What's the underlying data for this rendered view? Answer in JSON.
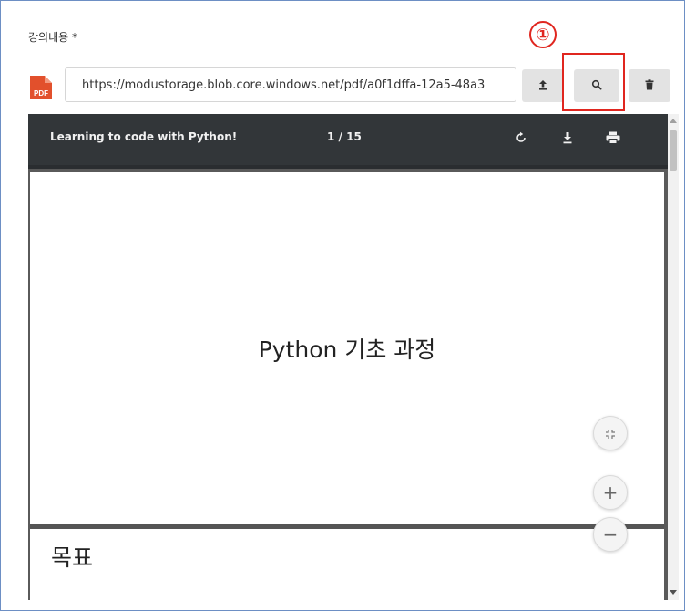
{
  "form": {
    "field_label": "강의내용 *",
    "url_value": "https://modustorage.blob.core.windows.net/pdf/a0f1dffa-12a5-48a3",
    "file_type_badge": "PDF"
  },
  "annotation": {
    "step_number": "①",
    "color": "#e0261f"
  },
  "toolbar_buttons": {
    "upload_icon": "upload-icon",
    "search_icon": "search-icon",
    "delete_icon": "trash-icon"
  },
  "viewer": {
    "document_title": "Learning to code with Python!",
    "page_counter": "1 / 15",
    "toolbar_icons": [
      "rotate-icon",
      "download-icon",
      "print-icon"
    ],
    "pages": [
      {
        "heading": "Python 기초 과정"
      },
      {
        "heading": "목표"
      }
    ],
    "zoom_controls": {
      "fit": "fit-to-page-icon",
      "zoom_in": "+",
      "zoom_out": "−"
    }
  },
  "colors": {
    "viewer_toolbar": "#323639",
    "button_bg": "#e3e3e3",
    "frame_border": "#6d8fc4",
    "pdf_badge": "#e2502c"
  }
}
